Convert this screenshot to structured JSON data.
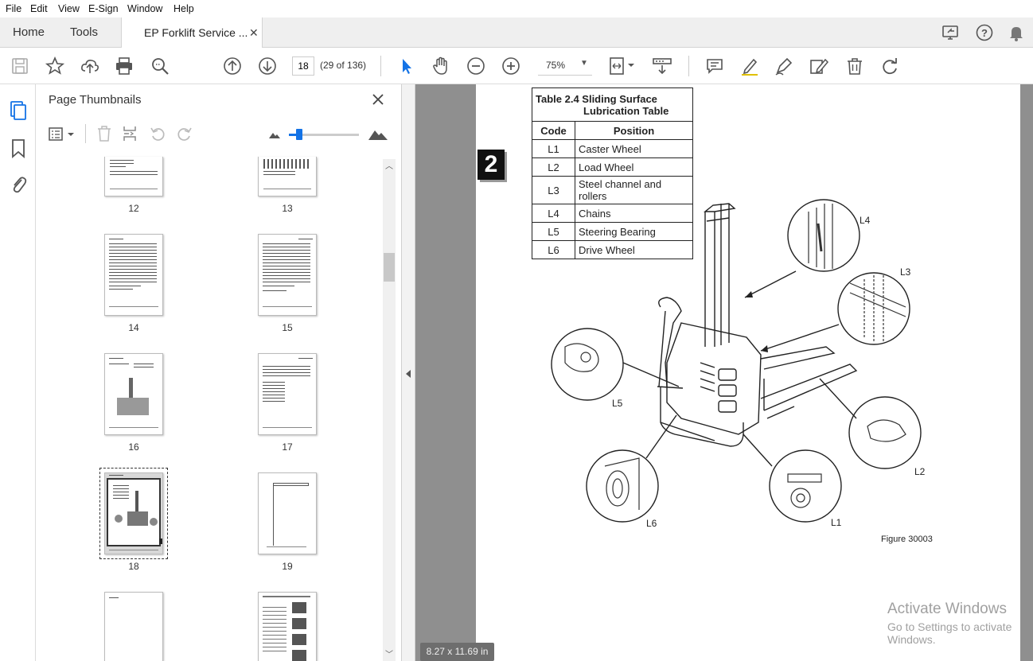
{
  "menu": [
    "File",
    "Edit",
    "View",
    "E-Sign",
    "Window",
    "Help"
  ],
  "tabs": {
    "home": "Home",
    "tools": "Tools",
    "document": "EP Forklift Service ..."
  },
  "toolbar": {
    "page_number": "18",
    "page_count": "(29 of 136)",
    "zoom": "75%"
  },
  "panel": {
    "title": "Page Thumbnails",
    "thumbnails": [
      "12",
      "13",
      "14",
      "15",
      "16",
      "17",
      "18",
      "19"
    ],
    "selected": "18"
  },
  "document": {
    "page_badge": "2",
    "table_title_line1": "Table 2.4 Sliding Surface",
    "table_title_line2": "Lubrication Table",
    "headers": {
      "code": "Code",
      "position": "Position"
    },
    "rows": [
      {
        "code": "L1",
        "position": "Caster Wheel"
      },
      {
        "code": "L2",
        "position": "Load Wheel"
      },
      {
        "code": "L3",
        "position": "Steel channel and rollers"
      },
      {
        "code": "L4",
        "position": "Chains"
      },
      {
        "code": "L5",
        "position": "Steering Bearing"
      },
      {
        "code": "L6",
        "position": "Drive Wheel"
      }
    ],
    "callouts": {
      "l1": "L1",
      "l2": "L2",
      "l3": "L3",
      "l4": "L4",
      "l5": "L5",
      "l6": "L6"
    },
    "figure_caption": "Figure 30003"
  },
  "page_size": "8.27 x 11.69 in",
  "watermark": {
    "line1": "Activate Windows",
    "line2": "Go to Settings to activate Windows."
  },
  "colors": {
    "accent": "#1473e6",
    "doc_background": "#8f8f8f",
    "toolbar_icon": "#555555"
  }
}
